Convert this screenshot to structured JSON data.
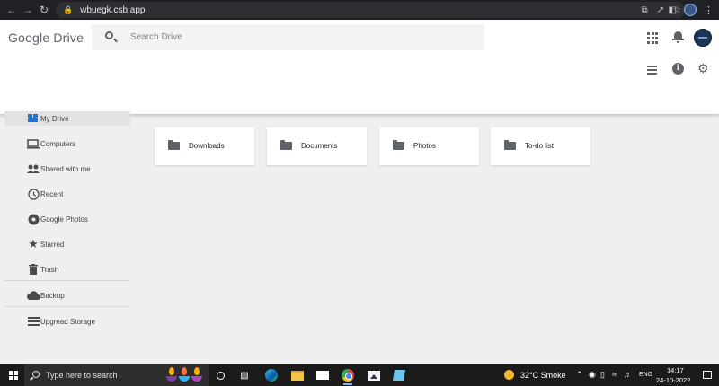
{
  "browser": {
    "url": "wbuegk.csb.app"
  },
  "header": {
    "app_name": "Google Drive",
    "search_placeholder": "Search Drive"
  },
  "sidebar": {
    "items": [
      {
        "label": "My Drive",
        "icon": "drive-icon",
        "active": true
      },
      {
        "label": "Computers",
        "icon": "computer-icon"
      },
      {
        "label": "Shared with me",
        "icon": "people-icon"
      },
      {
        "label": "Recent",
        "icon": "clock-icon"
      },
      {
        "label": "Google Photos",
        "icon": "pinwheel-icon"
      },
      {
        "label": "Starred",
        "icon": "star-icon"
      },
      {
        "label": "Trash",
        "icon": "trash-icon"
      },
      {
        "label": "Backup",
        "icon": "cloud-icon"
      },
      {
        "label": "Upgread Storage",
        "icon": "storage-icon"
      }
    ]
  },
  "folders": [
    {
      "name": "Downloads"
    },
    {
      "name": "Documents"
    },
    {
      "name": "Photos"
    },
    {
      "name": "To-do list"
    }
  ],
  "taskbar": {
    "search_placeholder": "Type here to search",
    "weather": "32°C  Smoke",
    "language": "ENG",
    "time": "14:17",
    "date": "24-10-2022"
  }
}
